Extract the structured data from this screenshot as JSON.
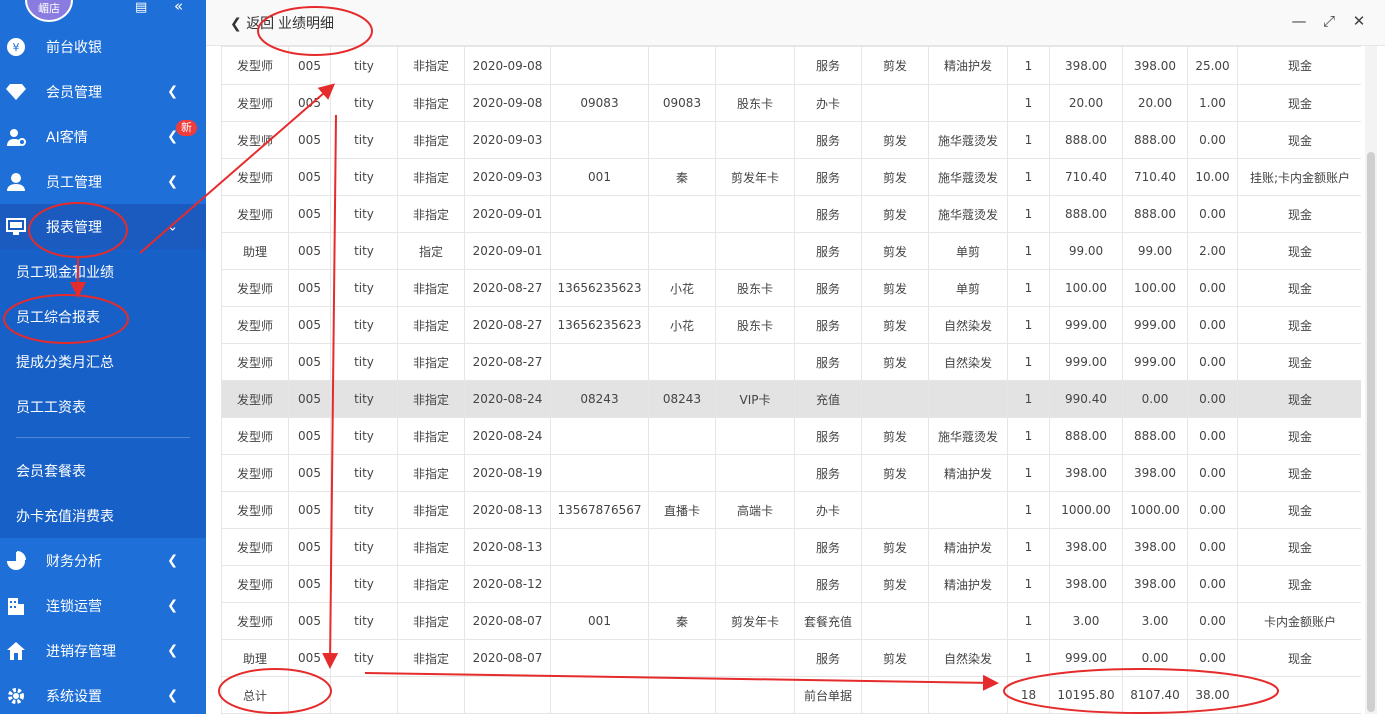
{
  "sidebar": {
    "avatar_text": "嵋店",
    "top_icons": [
      "monitor-icon",
      "double-chevron-left-icon"
    ],
    "items": [
      {
        "label": "前台收银",
        "icon": "yen-icon"
      },
      {
        "label": "会员管理",
        "icon": "diamond-icon"
      },
      {
        "label": "AI客情",
        "icon": "user-gear-icon",
        "badge": "新"
      },
      {
        "label": "员工管理",
        "icon": "person-icon"
      },
      {
        "label": "报表管理",
        "icon": "monitor-chart-icon"
      }
    ],
    "sub_items": [
      "员工现金和业绩",
      "员工综合报表",
      "提成分类月汇总",
      "员工工资表"
    ],
    "sub_items2": [
      "会员套餐表",
      "办卡充值消费表"
    ],
    "items_bottom": [
      {
        "label": "财务分析",
        "icon": "pie-chart-icon"
      },
      {
        "label": "连锁运营",
        "icon": "building-icon"
      },
      {
        "label": "进销存管理",
        "icon": "home-icon"
      },
      {
        "label": "系统设置",
        "icon": "gear-icon"
      }
    ]
  },
  "titlebar": {
    "back_label": "返回",
    "title": "业绩明细",
    "controls": [
      "minimize-icon",
      "maximize-icon",
      "close-icon"
    ]
  },
  "table": {
    "rows": [
      [
        "发型师",
        "005",
        "tity",
        "非指定",
        "2020-09-08",
        "",
        "",
        "",
        "服务",
        "剪发",
        "精油护发",
        "1",
        "398.00",
        "398.00",
        "25.00",
        "现金"
      ],
      [
        "发型师",
        "005",
        "tity",
        "非指定",
        "2020-09-08",
        "09083",
        "09083",
        "股东卡",
        "办卡",
        "",
        "",
        "1",
        "20.00",
        "20.00",
        "1.00",
        "现金"
      ],
      [
        "发型师",
        "005",
        "tity",
        "非指定",
        "2020-09-03",
        "",
        "",
        "",
        "服务",
        "剪发",
        "施华蔻烫发",
        "1",
        "888.00",
        "888.00",
        "0.00",
        "现金"
      ],
      [
        "发型师",
        "005",
        "tity",
        "非指定",
        "2020-09-03",
        "001",
        "秦",
        "剪发年卡",
        "服务",
        "剪发",
        "施华蔻烫发",
        "1",
        "710.40",
        "710.40",
        "10.00",
        "挂账;卡内金额账户"
      ],
      [
        "发型师",
        "005",
        "tity",
        "非指定",
        "2020-09-01",
        "",
        "",
        "",
        "服务",
        "剪发",
        "施华蔻烫发",
        "1",
        "888.00",
        "888.00",
        "0.00",
        "现金"
      ],
      [
        "助理",
        "005",
        "tity",
        "指定",
        "2020-09-01",
        "",
        "",
        "",
        "服务",
        "剪发",
        "单剪",
        "1",
        "99.00",
        "99.00",
        "2.00",
        "现金"
      ],
      [
        "发型师",
        "005",
        "tity",
        "非指定",
        "2020-08-27",
        "13656235623",
        "小花",
        "股东卡",
        "服务",
        "剪发",
        "单剪",
        "1",
        "100.00",
        "100.00",
        "0.00",
        "现金"
      ],
      [
        "发型师",
        "005",
        "tity",
        "非指定",
        "2020-08-27",
        "13656235623",
        "小花",
        "股东卡",
        "服务",
        "剪发",
        "自然染发",
        "1",
        "999.00",
        "999.00",
        "0.00",
        "现金"
      ],
      [
        "发型师",
        "005",
        "tity",
        "非指定",
        "2020-08-27",
        "",
        "",
        "",
        "服务",
        "剪发",
        "自然染发",
        "1",
        "999.00",
        "999.00",
        "0.00",
        "现金"
      ],
      [
        "发型师",
        "005",
        "tity",
        "非指定",
        "2020-08-24",
        "08243",
        "08243",
        "VIP卡",
        "充值",
        "",
        "",
        "1",
        "990.40",
        "0.00",
        "0.00",
        "现金"
      ],
      [
        "发型师",
        "005",
        "tity",
        "非指定",
        "2020-08-24",
        "",
        "",
        "",
        "服务",
        "剪发",
        "施华蔻烫发",
        "1",
        "888.00",
        "888.00",
        "0.00",
        "现金"
      ],
      [
        "发型师",
        "005",
        "tity",
        "非指定",
        "2020-08-19",
        "",
        "",
        "",
        "服务",
        "剪发",
        "精油护发",
        "1",
        "398.00",
        "398.00",
        "0.00",
        "现金"
      ],
      [
        "发型师",
        "005",
        "tity",
        "非指定",
        "2020-08-13",
        "13567876567",
        "直播卡",
        "高端卡",
        "办卡",
        "",
        "",
        "1",
        "1000.00",
        "1000.00",
        "0.00",
        "现金"
      ],
      [
        "发型师",
        "005",
        "tity",
        "非指定",
        "2020-08-13",
        "",
        "",
        "",
        "服务",
        "剪发",
        "精油护发",
        "1",
        "398.00",
        "398.00",
        "0.00",
        "现金"
      ],
      [
        "发型师",
        "005",
        "tity",
        "非指定",
        "2020-08-12",
        "",
        "",
        "",
        "服务",
        "剪发",
        "精油护发",
        "1",
        "398.00",
        "398.00",
        "0.00",
        "现金"
      ],
      [
        "发型师",
        "005",
        "tity",
        "非指定",
        "2020-08-07",
        "001",
        "秦",
        "剪发年卡",
        "套餐充值",
        "",
        "",
        "1",
        "3.00",
        "3.00",
        "0.00",
        "卡内金额账户"
      ],
      [
        "助理",
        "005",
        "tity",
        "非指定",
        "2020-08-07",
        "",
        "",
        "",
        "服务",
        "剪发",
        "自然染发",
        "1",
        "999.00",
        "0.00",
        "0.00",
        "现金"
      ]
    ],
    "highlighted_row": 9,
    "total": [
      "总计",
      "",
      "",
      "",
      "",
      "",
      "",
      "",
      "前台单据",
      "",
      "",
      "18",
      "10195.80",
      "8107.40",
      "38.00",
      ""
    ]
  }
}
